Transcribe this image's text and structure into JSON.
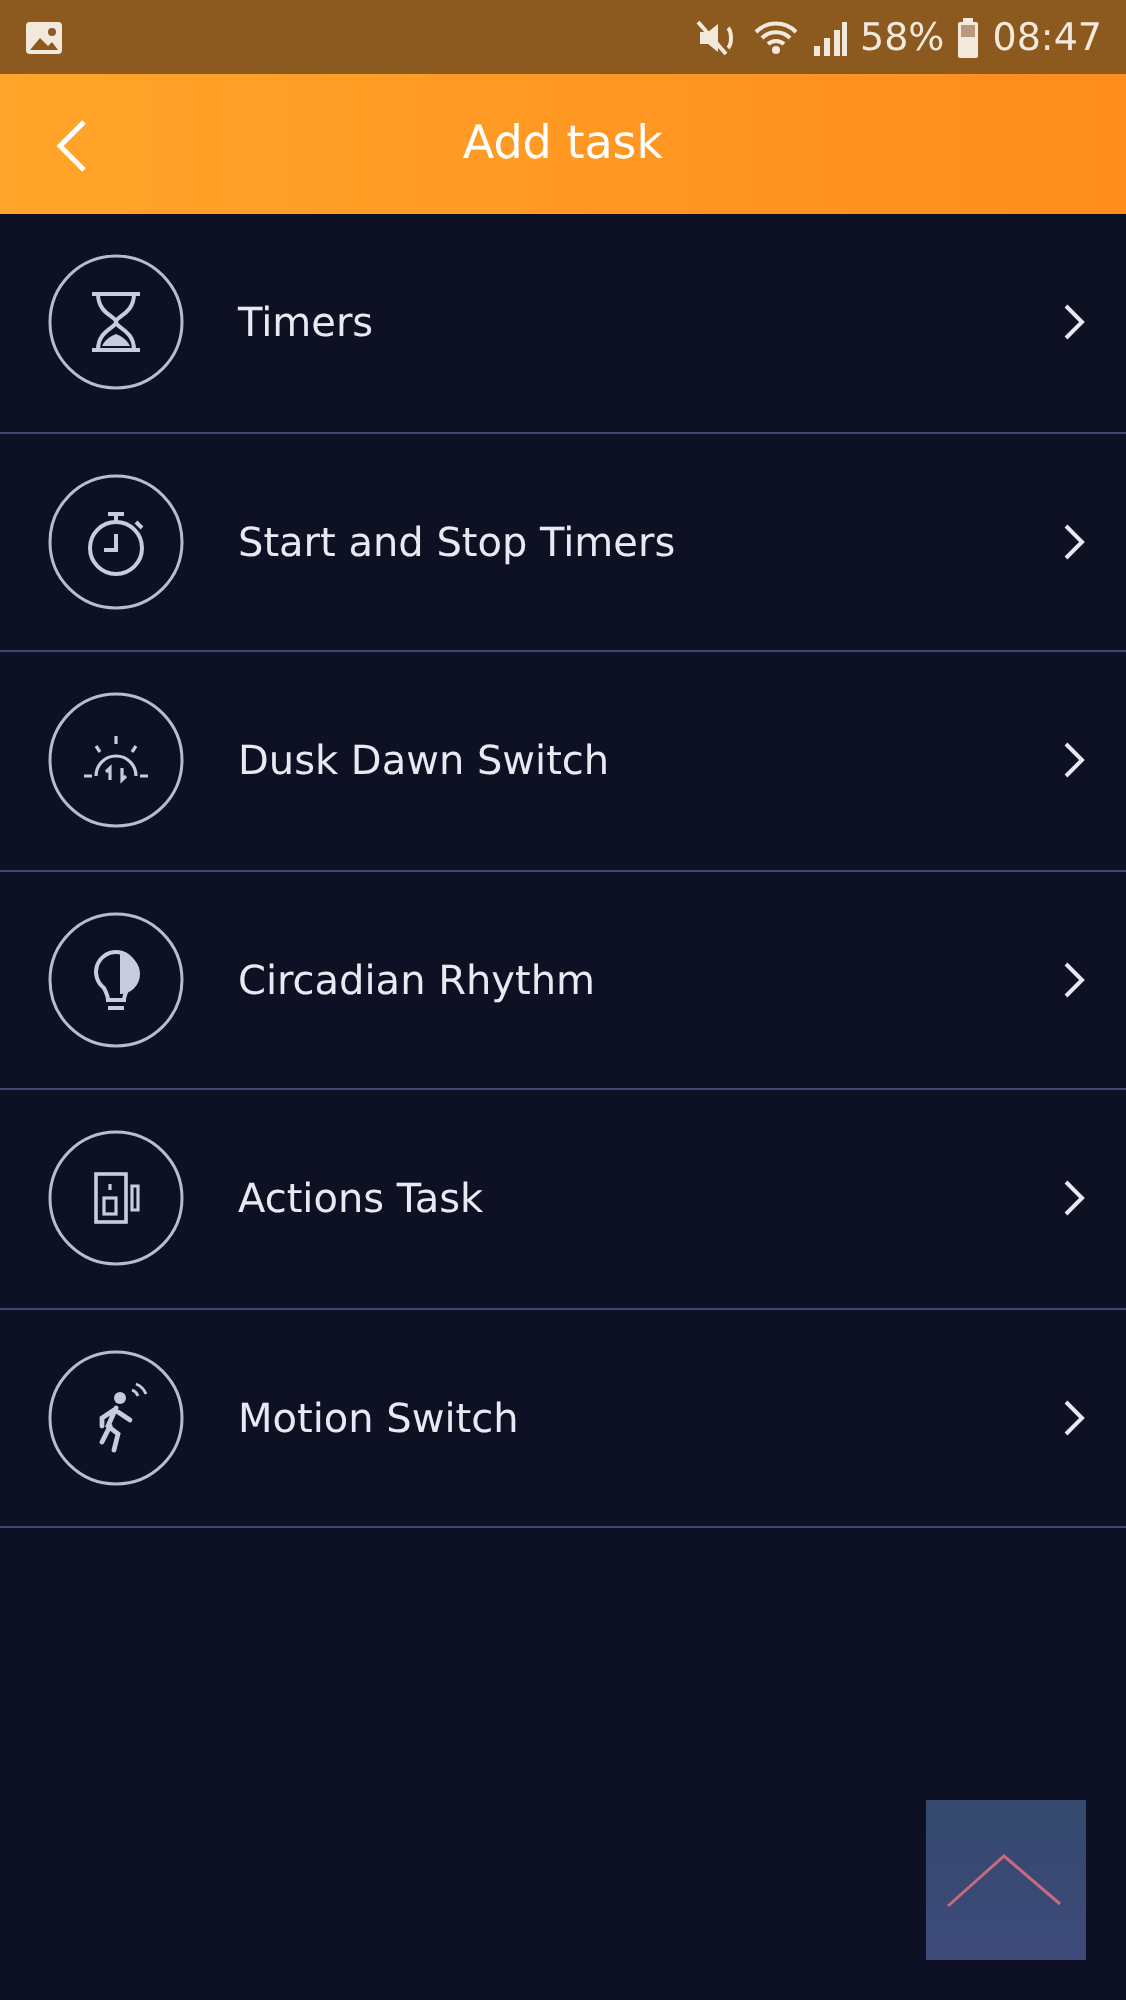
{
  "status_bar": {
    "battery": "58%",
    "time": "08:47"
  },
  "header": {
    "title": "Add task"
  },
  "tasks": [
    {
      "kind": "hourglass",
      "label": "Timers"
    },
    {
      "kind": "stopwatch",
      "label": "Start and Stop Timers"
    },
    {
      "kind": "dusk",
      "label": "Dusk Dawn Switch"
    },
    {
      "kind": "bulb",
      "label": "Circadian Rhythm"
    },
    {
      "kind": "switch",
      "label": "Actions Task"
    },
    {
      "kind": "motion",
      "label": "Motion Switch"
    }
  ]
}
